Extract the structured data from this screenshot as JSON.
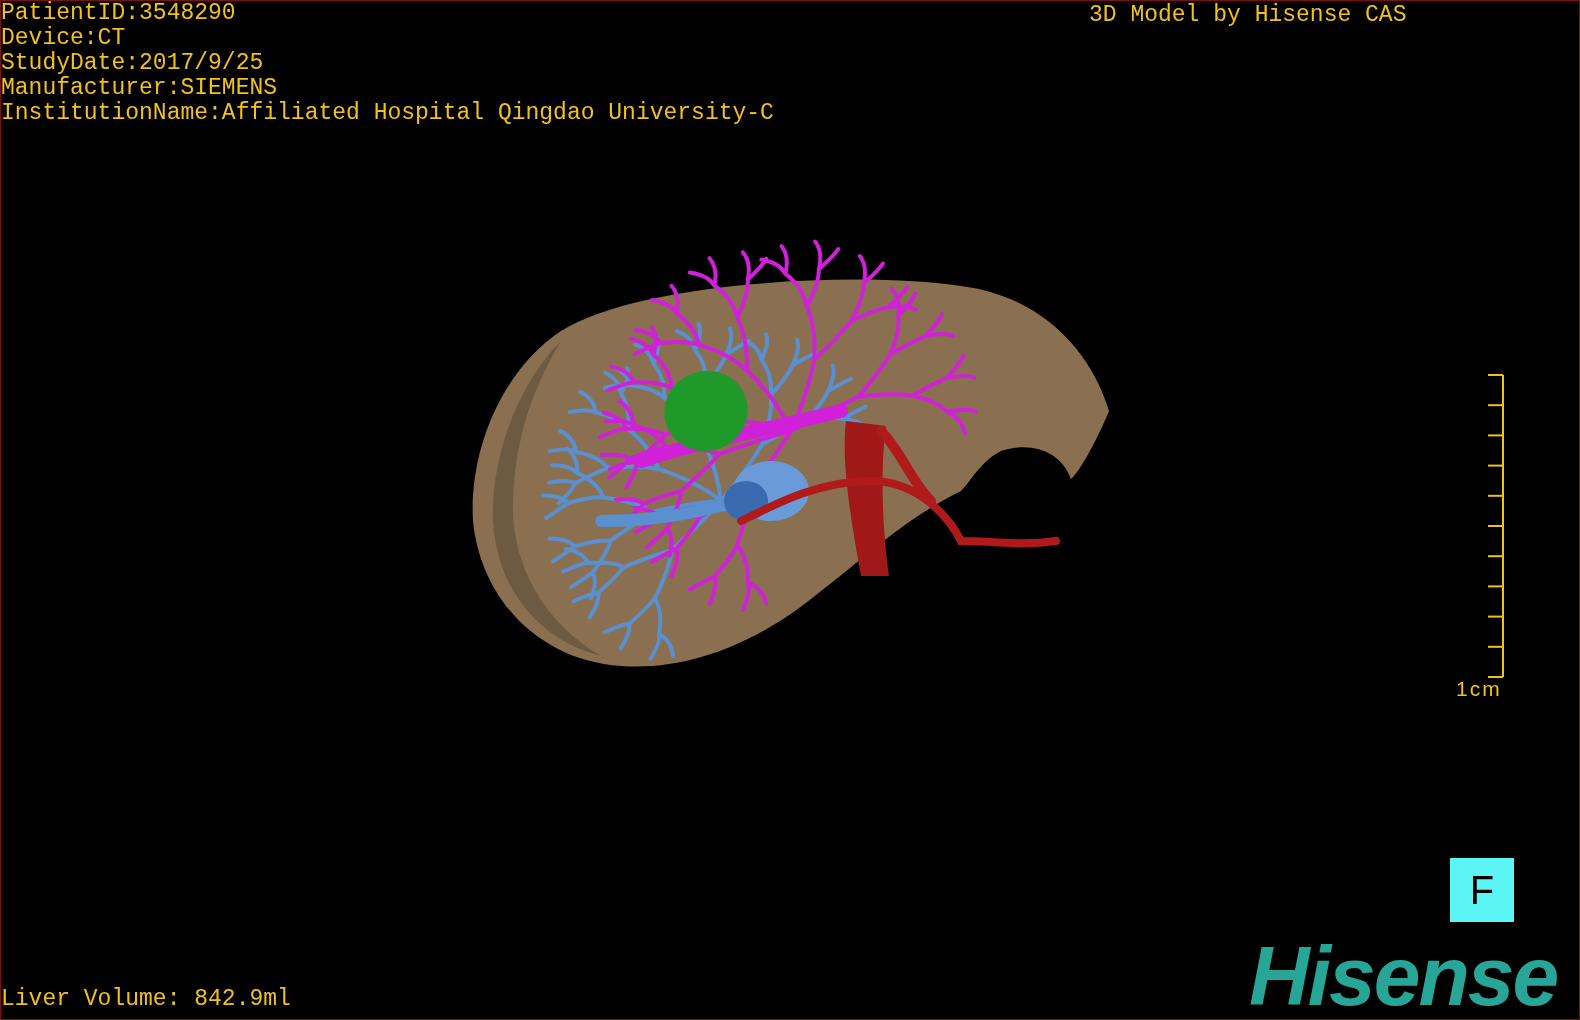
{
  "patient_info": [
    "PatientID:3548290",
    "Device:CT",
    "StudyDate:2017/9/25",
    "Manufacturer:SIEMENS",
    "InstitutionName:Affiliated Hospital Qingdao University-C"
  ],
  "credit": "3D Model by Hisense CAS",
  "scale": {
    "label": "1cm"
  },
  "orientation_marker": "F",
  "logo": "Hisense",
  "liver_volume": "Liver Volume: 842.9ml"
}
